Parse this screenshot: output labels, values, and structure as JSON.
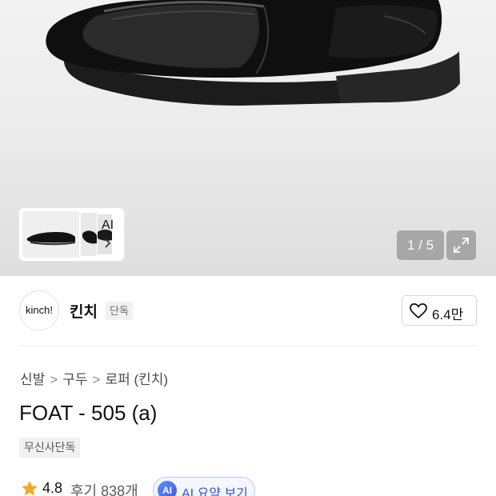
{
  "gallery": {
    "thumb_label": "AI",
    "counter": "1 / 5",
    "icons": {
      "expand": "expand-icon",
      "chevron": "chevron-right-icon"
    }
  },
  "brand": {
    "logo_text": "kinch!",
    "name": "킨치",
    "tag": "단독",
    "like_count": "6.4만",
    "like_icon": "heart-icon"
  },
  "breadcrumb": [
    "신발",
    "구두",
    "로퍼 (킨치)"
  ],
  "product": {
    "title": "FOAT - 505 (a)",
    "promo_tag": "무신사단독"
  },
  "rating": {
    "value": "4.8",
    "review_label": "후기 838개",
    "star_color": "#f5a623",
    "ai_badge": "AI",
    "ai_summary_label": "AI 요약 보기"
  },
  "colors": {
    "ai_accent": "#2f55d4",
    "tag_bg": "#f1f1f1"
  }
}
